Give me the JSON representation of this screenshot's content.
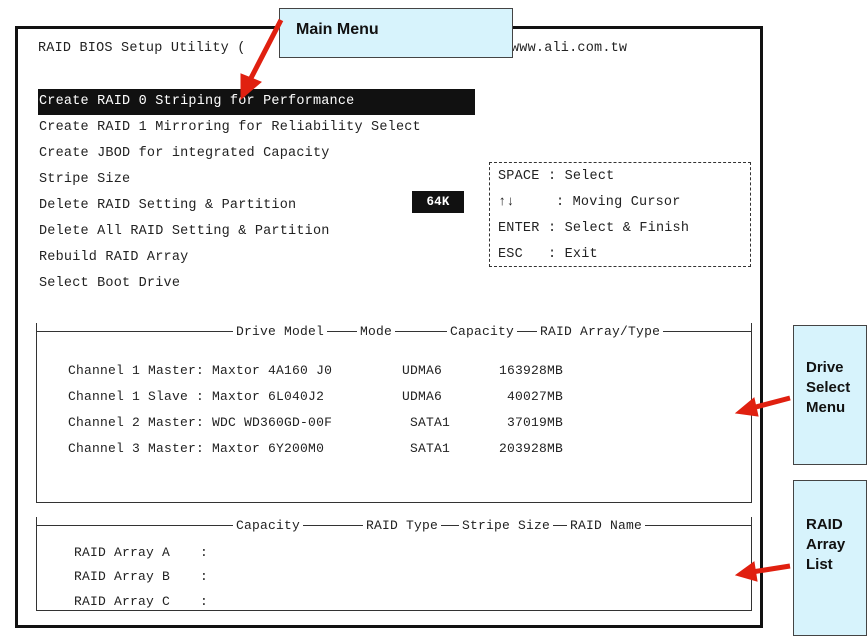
{
  "bios": {
    "title": "RAID BIOS Setup Utility (",
    "url": "www.ali.com.tw"
  },
  "main_menu": {
    "items": [
      "Create RAID 0 Striping for Performance",
      "Create RAID 1 Mirroring for Reliability Select",
      "Create JBOD for integrated Capacity",
      "Stripe Size",
      "Delete RAID Setting & Partition",
      "Delete All RAID Setting & Partition",
      "Rebuild RAID Array",
      "Select Boot Drive"
    ],
    "selected_index": 0,
    "stripe_size_value": "64K"
  },
  "keys": {
    "items": [
      {
        "key": "SPACE",
        "sep": ":",
        "action": "Select"
      },
      {
        "key": "↑↓",
        "sep": "",
        "action": ": Moving Cursor"
      },
      {
        "key": "ENTER",
        "sep": ":",
        "action": "Select & Finish"
      },
      {
        "key": "ESC",
        "sep": ":",
        "action": "Exit"
      }
    ]
  },
  "drive_menu": {
    "headers": [
      "Drive Model",
      "Mode",
      "Capacity",
      "RAID Array/Type"
    ],
    "rows": [
      {
        "channel": "Channel 1 Master:",
        "model": "Maxtor 4A160 J0",
        "mode": "UDMA6",
        "capacity": "163928MB"
      },
      {
        "channel": "Channel 1 Slave :",
        "model": "Maxtor 6L040J2",
        "mode": "UDMA6",
        "capacity": "40027MB"
      },
      {
        "channel": "Channel 2 Master:",
        "model": "WDC WD360GD-00F",
        "mode": "SATA1",
        "capacity": "37019MB"
      },
      {
        "channel": "Channel 3 Master:",
        "model": "Maxtor 6Y200M0",
        "mode": "SATA1",
        "capacity": "203928MB"
      }
    ]
  },
  "array_list": {
    "headers": [
      "Capacity",
      "RAID Type",
      "Stripe Size",
      "RAID Name"
    ],
    "rows": [
      {
        "name": "RAID Array A",
        "sep": ":"
      },
      {
        "name": "RAID Array B",
        "sep": ":"
      },
      {
        "name": "RAID Array C",
        "sep": ":"
      }
    ]
  },
  "callouts": {
    "main_menu": "Main Menu",
    "drive_select": [
      "Drive",
      "Select",
      "Menu"
    ],
    "raid_array_list": [
      "RAID",
      "Array",
      "List"
    ]
  },
  "colors": {
    "callout_bg": "#d7f3fc",
    "arrow": "#e02010",
    "highlight_bg": "#111111"
  }
}
